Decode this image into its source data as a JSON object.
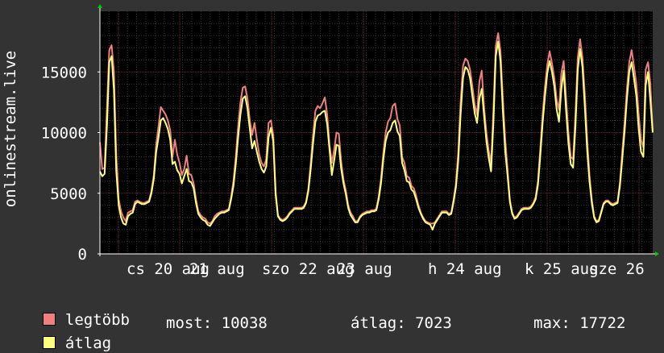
{
  "chart_data": {
    "type": "line",
    "ylabel": "onlinestream.live",
    "yticks": [
      0,
      5000,
      10000,
      15000
    ],
    "ylim": [
      0,
      20000
    ],
    "xticks": [
      "cs 20 aug",
      "21 aug",
      "szo 22 aug",
      "23 aug",
      "h 24 aug",
      "k 25 aug",
      "sze 26"
    ],
    "series": [
      {
        "name": "legtöbb",
        "color": "#f08080",
        "values": [
          9200,
          7000,
          7100,
          12000,
          16800,
          17200,
          15000,
          8000,
          4500,
          3500,
          3000,
          2700,
          3400,
          3500,
          3600,
          4300,
          4400,
          4300,
          4200,
          4200,
          4300,
          4400,
          5200,
          6500,
          9000,
          10500,
          12100,
          11800,
          11500,
          11000,
          10200,
          8000,
          9400,
          8200,
          7500,
          6500,
          7000,
          8100,
          6600,
          6500,
          5800,
          4500,
          3500,
          3200,
          3000,
          2900,
          2600,
          2500,
          2700,
          3100,
          3300,
          3400,
          3500,
          3500,
          3600,
          3700,
          4700,
          6000,
          8000,
          10500,
          12500,
          13700,
          13800,
          12800,
          11000,
          9800,
          10800,
          9400,
          8200,
          7500,
          7200,
          7800,
          10800,
          11000,
          9800,
          5200,
          3200,
          2900,
          2800,
          2900,
          3100,
          3400,
          3600,
          3800,
          3800,
          3800,
          3800,
          3900,
          4300,
          5400,
          7500,
          9800,
          11800,
          12200,
          12000,
          12400,
          12900,
          11500,
          9000,
          7500,
          8600,
          10000,
          9900,
          7600,
          6100,
          5200,
          4000,
          3400,
          3100,
          2700,
          2700,
          3100,
          3300,
          3400,
          3500,
          3500,
          3600,
          3600,
          3700,
          4700,
          6200,
          8300,
          10000,
          10900,
          11200,
          12200,
          12400,
          11100,
          10600,
          8000,
          7500,
          6400,
          6300,
          5600,
          5400,
          4800,
          4000,
          3400,
          3000,
          2700,
          2600,
          2500,
          2500,
          2600,
          2900,
          3200,
          3500,
          3500,
          3500,
          3300,
          3400,
          4500,
          5800,
          8400,
          12500,
          15500,
          16100,
          15900,
          15200,
          13800,
          12300,
          11500,
          14200,
          15100,
          12100,
          10000,
          8500,
          7500,
          11800,
          17100,
          18200,
          16700,
          12800,
          9500,
          7000,
          4500,
          3400,
          3000,
          3100,
          3400,
          3700,
          3800,
          3800,
          3800,
          3900,
          4200,
          4700,
          6000,
          8700,
          11500,
          13800,
          15600,
          16700,
          15700,
          14500,
          12700,
          11900,
          14900,
          15900,
          12900,
          10000,
          8000,
          7800,
          11500,
          16200,
          17700,
          16200,
          13200,
          9500,
          6500,
          4500,
          3100,
          2700,
          2800,
          3500,
          4200,
          4400,
          4400,
          4200,
          4100,
          4200,
          4300,
          5900,
          8400,
          10800,
          13600,
          15800,
          16800,
          15500,
          14000,
          11500,
          9400,
          8800,
          15200,
          15800,
          14000,
          10100
        ]
      },
      {
        "name": "átlag",
        "color": "#ffff80",
        "values": [
          6800,
          6400,
          6600,
          10500,
          15800,
          16300,
          13500,
          6800,
          4000,
          3000,
          2500,
          2400,
          3100,
          3300,
          3400,
          4100,
          4300,
          4200,
          4100,
          4100,
          4200,
          4300,
          5000,
          6200,
          8400,
          9600,
          11000,
          11200,
          10800,
          10300,
          9400,
          7400,
          7600,
          6900,
          6600,
          5800,
          6400,
          7000,
          6000,
          5900,
          5400,
          4200,
          3300,
          3000,
          2800,
          2700,
          2400,
          2300,
          2600,
          2900,
          3100,
          3300,
          3400,
          3400,
          3500,
          3600,
          4500,
          5600,
          7400,
          9600,
          11500,
          12800,
          13000,
          12000,
          10300,
          8700,
          9300,
          8400,
          7600,
          7000,
          6700,
          7200,
          9600,
          10400,
          9300,
          4900,
          3100,
          2800,
          2700,
          2800,
          3000,
          3300,
          3500,
          3700,
          3700,
          3700,
          3700,
          3800,
          4200,
          5200,
          7000,
          9100,
          10900,
          11400,
          11500,
          11700,
          11800,
          10700,
          8600,
          6500,
          7700,
          9000,
          8900,
          7000,
          5800,
          4900,
          3800,
          3200,
          2900,
          2600,
          2600,
          3000,
          3200,
          3300,
          3400,
          3400,
          3500,
          3500,
          3600,
          4500,
          5800,
          7800,
          9300,
          10000,
          10200,
          10800,
          11000,
          10100,
          9700,
          7500,
          6900,
          6000,
          5900,
          5300,
          5100,
          4500,
          3800,
          3300,
          2900,
          2600,
          2500,
          2400,
          2000,
          2500,
          2800,
          3100,
          3400,
          3400,
          3400,
          3200,
          3300,
          4300,
          5500,
          7700,
          11500,
          14500,
          15400,
          15200,
          14500,
          13000,
          11600,
          10800,
          12800,
          13600,
          11400,
          9300,
          7900,
          6800,
          10800,
          16300,
          17500,
          15900,
          11800,
          8500,
          6500,
          4300,
          3300,
          2900,
          3000,
          3300,
          3600,
          3700,
          3700,
          3700,
          3800,
          4100,
          4500,
          5700,
          8100,
          10800,
          13000,
          14900,
          15900,
          15000,
          13800,
          11900,
          10900,
          13600,
          15100,
          11900,
          9100,
          7400,
          7100,
          10500,
          15200,
          16900,
          15400,
          12200,
          8600,
          6000,
          4200,
          3000,
          2600,
          2700,
          3400,
          4100,
          4300,
          4300,
          4100,
          4000,
          4100,
          4200,
          5600,
          7800,
          10100,
          12800,
          15000,
          15800,
          14500,
          13000,
          10300,
          8400,
          8000,
          13900,
          15000,
          12600,
          10000
        ]
      }
    ]
  },
  "legend": {
    "max_label": "legtöbb",
    "avg_label": "átlag",
    "max_color": "#f08080",
    "avg_color": "#ffff80"
  },
  "stats": {
    "most": "most: 10038",
    "atlag": "átlag: 7023",
    "max": "max: 17722"
  }
}
